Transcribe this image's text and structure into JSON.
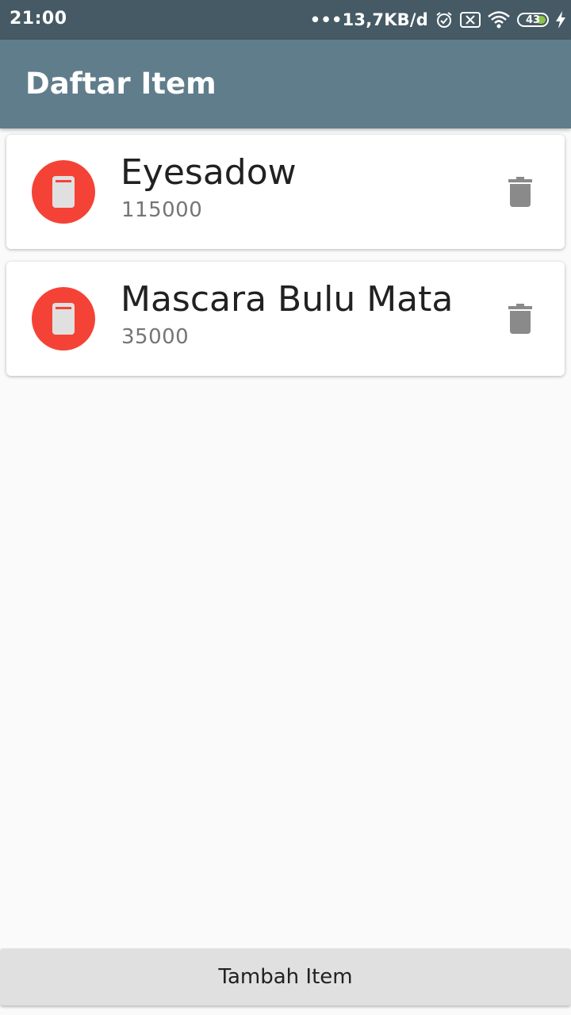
{
  "status_bar": {
    "time": "21:00",
    "net_speed": "•••13,7KB/d",
    "battery_level": "43",
    "battery_fraction": 0.43,
    "icons": [
      "alarm-icon",
      "no-sim-icon",
      "wifi-icon",
      "battery-icon",
      "charging-icon"
    ]
  },
  "app_bar": {
    "title": "Daftar Item"
  },
  "items": [
    {
      "name": "Eyesadow",
      "price": "115000",
      "icon": "phone-icon",
      "action_icon": "trash-icon"
    },
    {
      "name": "Mascara Bulu Mata",
      "price": "35000",
      "icon": "phone-icon",
      "action_icon": "trash-icon"
    }
  ],
  "footer": {
    "add_button_label": "Tambah Item"
  },
  "colors": {
    "status_bar": "#455a64",
    "app_bar": "#607d8b",
    "avatar": "#f44336",
    "delete_icon": "#8a8a8a",
    "background": "#fafafa",
    "button": "#e0e0e0",
    "battery_fill": "#8bc34a"
  }
}
